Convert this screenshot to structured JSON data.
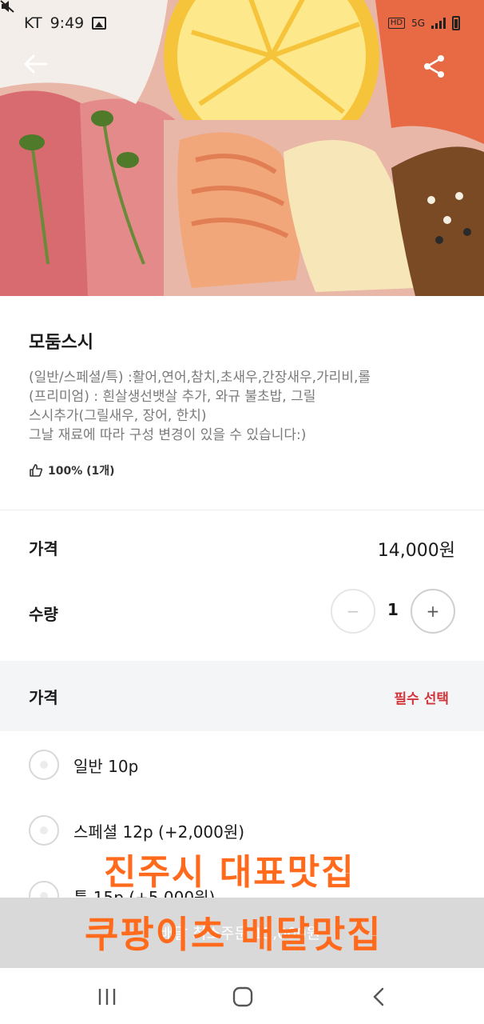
{
  "status_bar": {
    "carrier": "KT",
    "time": "9:49",
    "hd_badge": "HD",
    "network": "5G"
  },
  "product": {
    "name": "모둠스시",
    "description": [
      "(일반/스페셜/특) :활어,연어,참치,초새우,간장새우,가리비,롤",
      "(프리미엄) : 흰살생선뱃살 추가, 와규 불초밥, 그릴",
      "스시추가(그릴새우, 장어, 한치)",
      "그날 재료에 따라 구성 변경이 있을 수 있습니다:)"
    ],
    "rating": "100% (1개)"
  },
  "price_row": {
    "label": "가격",
    "value": "14,000원"
  },
  "quantity_row": {
    "label": "수량",
    "value": "1",
    "minus": "−",
    "plus": "+"
  },
  "option_group": {
    "title": "가격",
    "required_label": "필수 선택",
    "options": [
      {
        "label": "일반 10p"
      },
      {
        "label": "스페셜 12p (+2,000원)"
      },
      {
        "label": "특 15p (+5,000원)"
      }
    ]
  },
  "cart_button": {
    "label": "배달 최소주문 13,000원"
  },
  "watermark": {
    "line1": "진주시 대표맛집",
    "line2": "쿠팡이츠 배달맛집"
  },
  "colors": {
    "accent_required": "#d2353b",
    "watermark": "#ff6a1c",
    "section_bg": "#f4f5f7"
  }
}
